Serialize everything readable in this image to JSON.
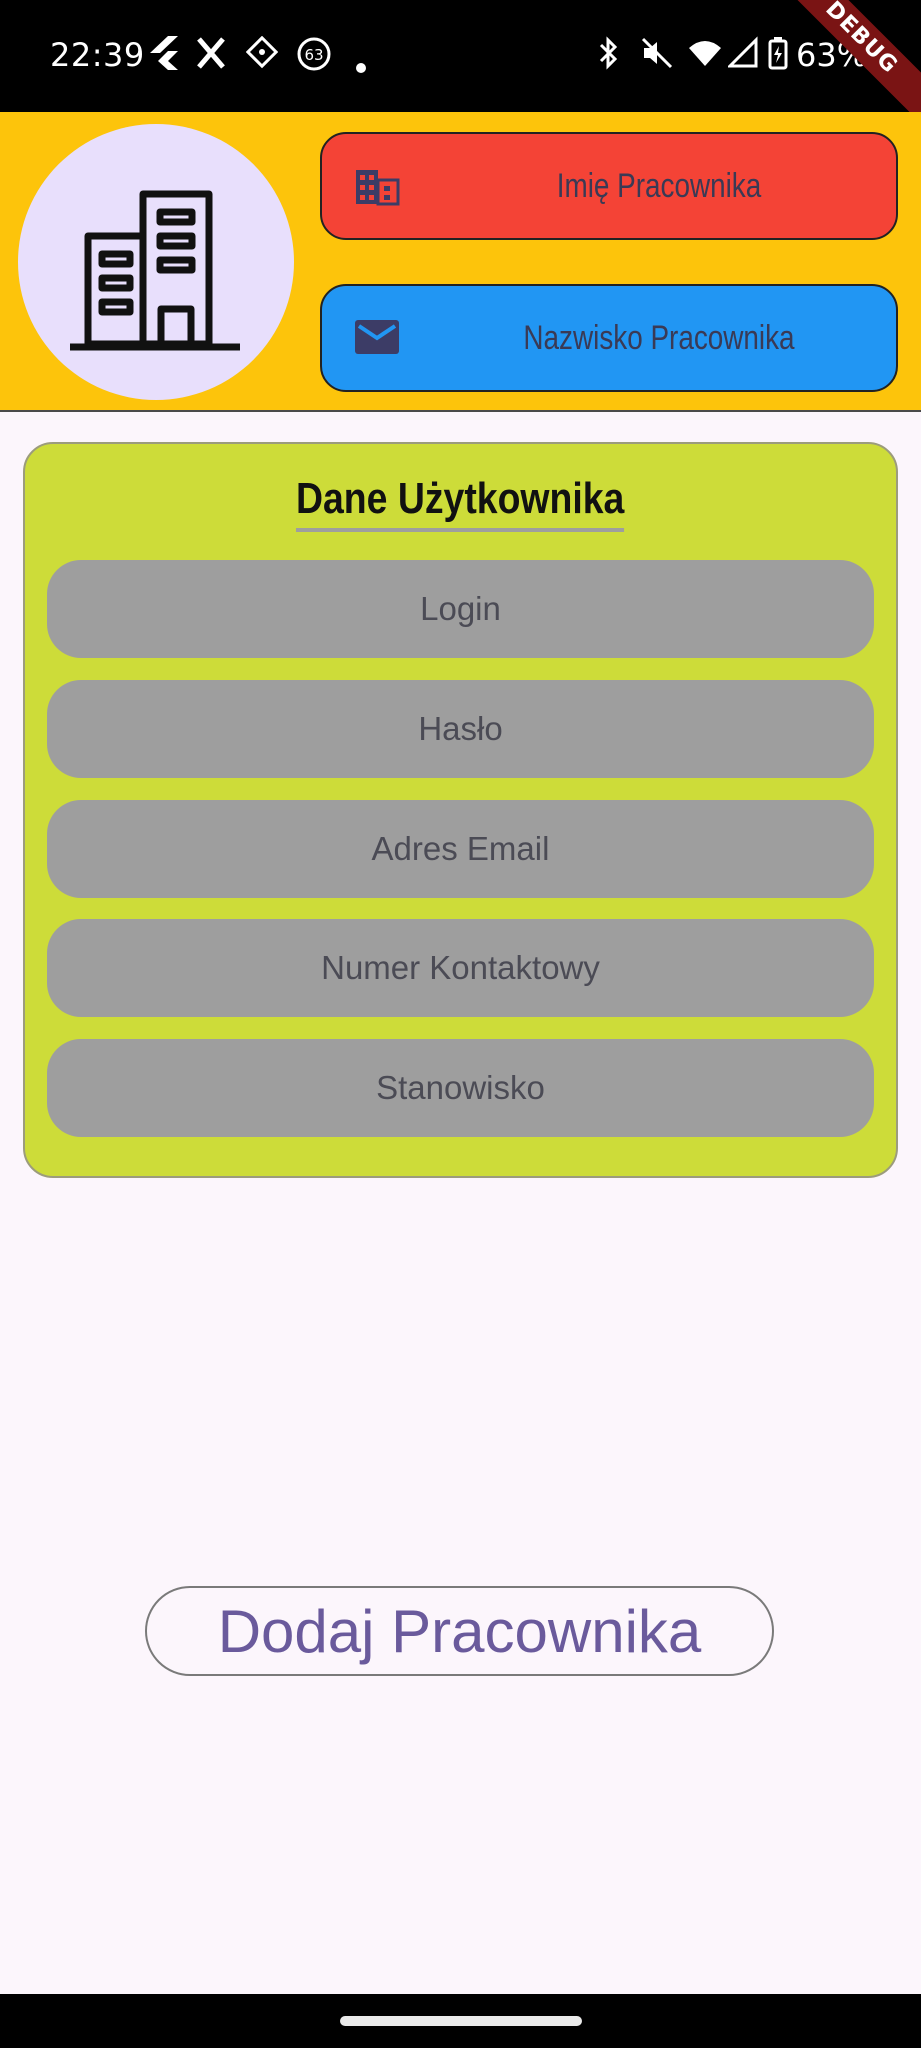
{
  "status_bar": {
    "time": "22:39",
    "notification_count": "63",
    "battery": "63%",
    "debug_label": "DEBUG",
    "left_icons": [
      "flutter-icon",
      "x-icon",
      "app-icon",
      "badge-icon",
      "dot-icon"
    ],
    "right_icons": [
      "bluetooth-icon",
      "mute-icon",
      "wifi-icon",
      "signal-icon",
      "battery-icon"
    ]
  },
  "header": {
    "logo_icon": "building-icon",
    "first_name_button": {
      "label": "Imię Pracownika",
      "icon": "business-icon",
      "color": "#f44336"
    },
    "last_name_button": {
      "label": "Nazwisko Pracownika",
      "icon": "email-icon",
      "color": "#2196f3"
    },
    "background": "#fdc40b"
  },
  "card": {
    "title": "Dane Użytkownika",
    "background": "#cddc39",
    "fields": [
      {
        "label": "Login"
      },
      {
        "label": "Hasło"
      },
      {
        "label": "Adres Email"
      },
      {
        "label": "Numer Kontaktowy"
      },
      {
        "label": "Stanowisko"
      }
    ]
  },
  "actions": {
    "add_button": "Dodaj Pracownika"
  }
}
